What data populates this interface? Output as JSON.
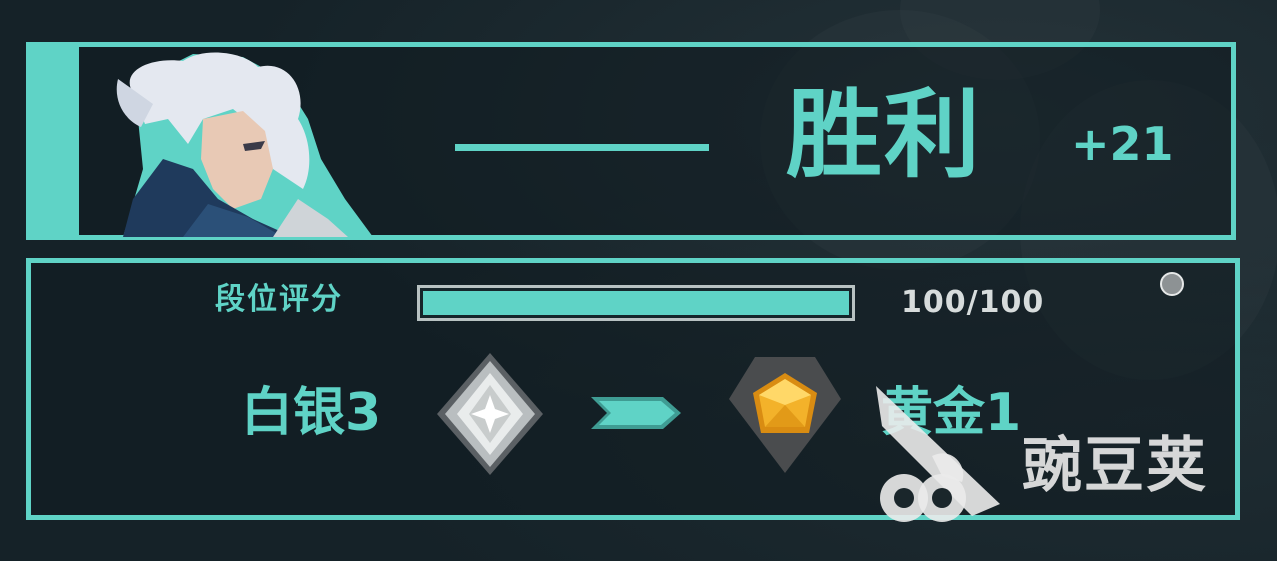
{
  "result": {
    "title": "胜利",
    "points": "+21",
    "portrait_icon": "agent-portrait"
  },
  "rank_score": {
    "label": "段位评分",
    "value": "100/100",
    "progress_fraction": 1.0
  },
  "rank_change": {
    "from": "白银3",
    "from_icon": "silver-rank-icon",
    "to": "黄金1",
    "to_icon": "gold-rank-icon",
    "arrow_icon": "arrow-right-icon"
  },
  "watermark": {
    "text": "豌豆荚"
  },
  "colors": {
    "accent": "#5fd3c6",
    "background": "#152228",
    "silver": "#c8cccc",
    "gold": "#f0a81e"
  }
}
